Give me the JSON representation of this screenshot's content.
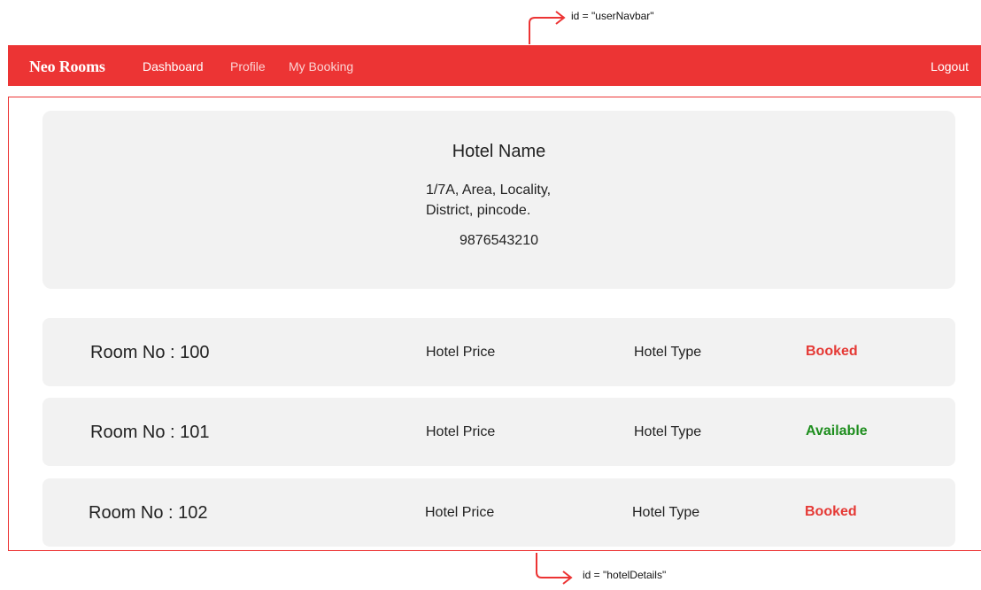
{
  "annotations": {
    "top_label": "id = \"userNavbar\"",
    "bottom_label": "id = \"hotelDetails\""
  },
  "navbar": {
    "brand": "Neo Rooms",
    "links": [
      {
        "label": "Dashboard",
        "active": true
      },
      {
        "label": "Profile",
        "active": false
      },
      {
        "label": "My Booking",
        "active": false
      }
    ],
    "logout": "Logout",
    "color": "#ec3434"
  },
  "hotel": {
    "name": "Hotel Name",
    "address_line1": "1/7A, Area, Locality,",
    "address_line2": "District, pincode.",
    "phone": "9876543210"
  },
  "rooms": [
    {
      "room_no": "Room No : 100",
      "price": "Hotel Price",
      "type": "Hotel Type",
      "status": "Booked",
      "status_color": "#e53935"
    },
    {
      "room_no": "Room No : 101",
      "price": "Hotel Price",
      "type": "Hotel Type",
      "status": "Available",
      "status_color": "#1e8e1e"
    },
    {
      "room_no": "Room No : 102",
      "price": "Hotel Price",
      "type": "Hotel Type",
      "status": "Booked",
      "status_color": "#e53935"
    }
  ]
}
